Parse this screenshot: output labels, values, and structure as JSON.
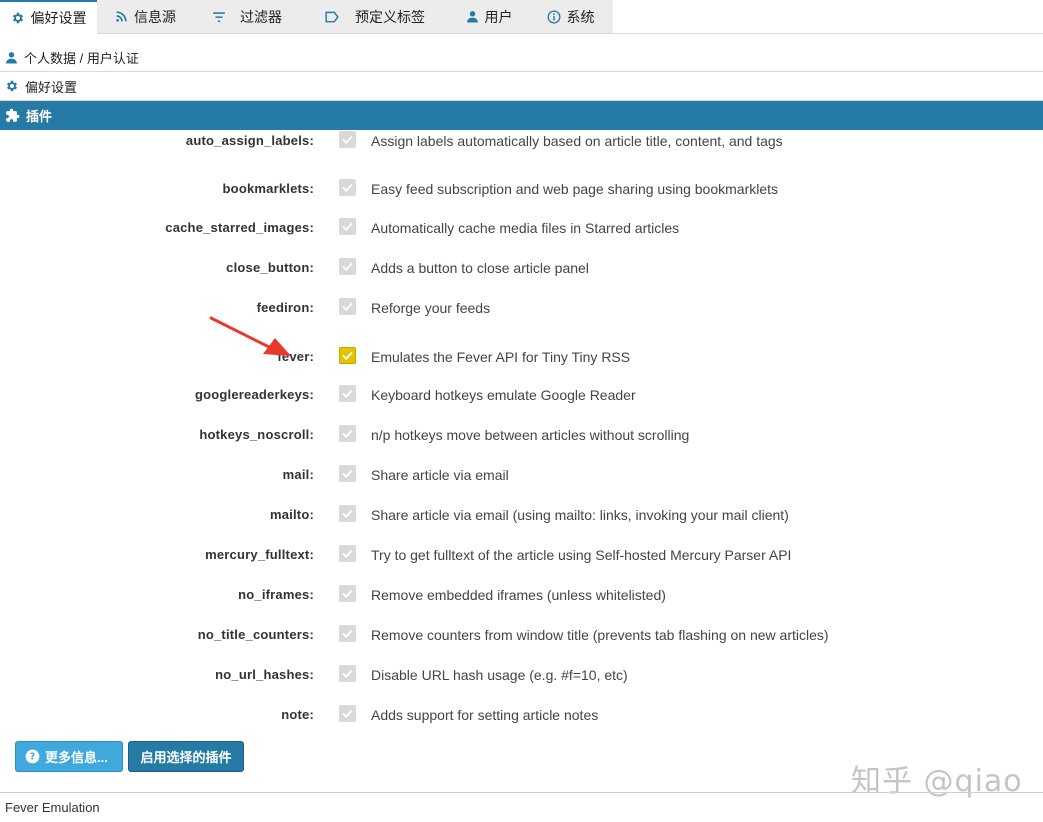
{
  "tabs": [
    {
      "label": "偏好设置",
      "icon": "gear-icon",
      "active": true
    },
    {
      "label": "信息源",
      "icon": "rss-icon",
      "active": false
    },
    {
      "label": "过滤器",
      "icon": "filter-icon",
      "active": false
    },
    {
      "label": "预定义标签",
      "icon": "label-icon",
      "active": false
    },
    {
      "label": "用户",
      "icon": "user-icon",
      "active": false
    },
    {
      "label": "系统",
      "icon": "info-icon",
      "active": false
    }
  ],
  "sections": {
    "profile": "个人数据 / 用户认证",
    "preferences": "偏好设置",
    "plugins": "插件"
  },
  "plugins": [
    {
      "name": "auto_assign_labels:",
      "desc": "Assign labels automatically based on article title, content, and tags",
      "checked": false
    },
    {
      "name": "bookmarklets:",
      "desc": "Easy feed subscription and web page sharing using bookmarklets",
      "checked": false
    },
    {
      "name": "cache_starred_images:",
      "desc": "Automatically cache media files in Starred articles",
      "checked": false
    },
    {
      "name": "close_button:",
      "desc": "Adds a button to close article panel",
      "checked": false
    },
    {
      "name": "feediron:",
      "desc": "Reforge your feeds",
      "checked": false
    },
    {
      "name": "fever:",
      "desc": "Emulates the Fever API for Tiny Tiny RSS",
      "checked": true
    },
    {
      "name": "googlereaderkeys:",
      "desc": "Keyboard hotkeys emulate Google Reader",
      "checked": false
    },
    {
      "name": "hotkeys_noscroll:",
      "desc": "n/p hotkeys move between articles without scrolling",
      "checked": false
    },
    {
      "name": "mail:",
      "desc": "Share article via email",
      "checked": false
    },
    {
      "name": "mailto:",
      "desc": "Share article via email (using mailto: links, invoking your mail client)",
      "checked": false
    },
    {
      "name": "mercury_fulltext:",
      "desc": "Try to get fulltext of the article using Self-hosted Mercury Parser API",
      "checked": false
    },
    {
      "name": "no_iframes:",
      "desc": "Remove embedded iframes (unless whitelisted)",
      "checked": false
    },
    {
      "name": "no_title_counters:",
      "desc": "Remove counters from window title (prevents tab flashing on new articles)",
      "checked": false
    },
    {
      "name": "no_url_hashes:",
      "desc": "Disable URL hash usage (e.g. #f=10, etc)",
      "checked": false
    },
    {
      "name": "note:",
      "desc": "Adds support for setting article notes",
      "checked": false
    }
  ],
  "buttons": {
    "more_info": "更多信息...",
    "enable_selected": "启用选择的插件"
  },
  "footer": "Fever Emulation",
  "watermark": "知乎 @qiao",
  "colors": {
    "accent": "#257aa6",
    "info_button": "#3fa8dd",
    "checked": "#e2c400",
    "annotation_arrow": "#e8392c"
  }
}
